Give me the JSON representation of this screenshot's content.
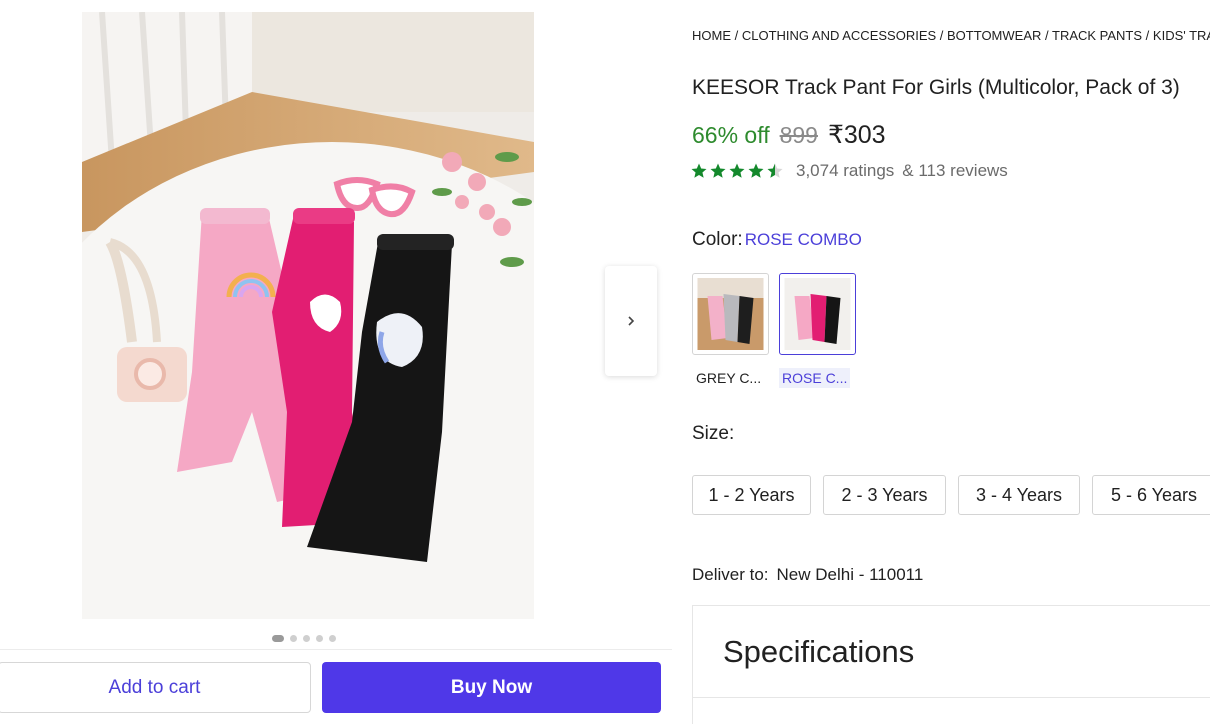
{
  "breadcrumb": [
    "HOME",
    "CLOTHING AND ACCESSORIES",
    "BOTTOMWEAR",
    "TRACK PANTS",
    "KIDS' TRACK"
  ],
  "product": {
    "title": "KEESOR Track Pant For Girls (Multicolor, Pack of 3)",
    "discount": "66% off",
    "mrp": "899",
    "price": "₹303",
    "rating_stars": 4.5,
    "ratings": "3,074 ratings",
    "reviews": "& 113 reviews"
  },
  "color": {
    "label": "Color:",
    "selected": "ROSE COMBO",
    "options": [
      {
        "name": "GREY C...",
        "selected": false
      },
      {
        "name": "ROSE C...",
        "selected": true
      }
    ]
  },
  "size": {
    "label": "Size:",
    "options": [
      "1 - 2 Years",
      "2 - 3 Years",
      "3 - 4 Years",
      "5 - 6 Years"
    ]
  },
  "delivery": {
    "label": "Deliver to:",
    "location": "New Delhi - 110011"
  },
  "specifications": {
    "title": "Specifications"
  },
  "actions": {
    "add_to_cart": "Add to cart",
    "buy_now": "Buy Now"
  },
  "gallery": {
    "dots": 5,
    "active_dot": 0
  },
  "colors": {
    "accent": "#4b3fd9",
    "buy_button": "#4f38e8",
    "discount": "#2e8b2e",
    "star": "#14892c"
  }
}
